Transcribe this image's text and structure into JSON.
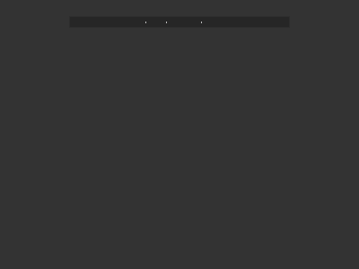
{
  "window": {
    "background": "#333333"
  },
  "toolbar": {
    "background": "#262626",
    "items": [
      {
        "icon": "toolbar-dot-icon",
        "label": ""
      },
      {
        "icon": "toolbar-dot-icon",
        "label": ""
      },
      {
        "icon": "toolbar-dot-icon",
        "label": ""
      }
    ]
  }
}
